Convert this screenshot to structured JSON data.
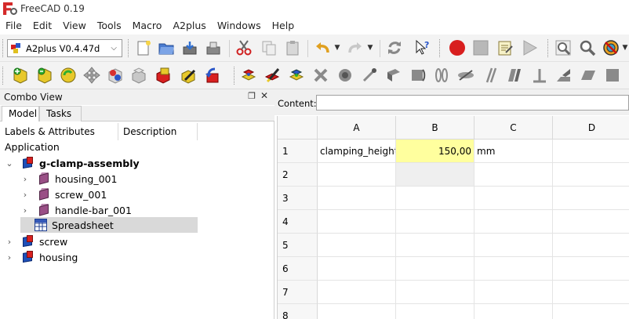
{
  "window": {
    "title": "FreeCAD 0.19"
  },
  "menu": [
    "File",
    "Edit",
    "View",
    "Tools",
    "Macro",
    "A2plus",
    "Windows",
    "Help"
  ],
  "workbench": {
    "selected": "A2plus V0.4.47d"
  },
  "combo_view": {
    "title": "Combo View",
    "tabs": [
      "Model",
      "Tasks"
    ],
    "active_tab": "Model",
    "columns": [
      "Labels & Attributes",
      "Description"
    ],
    "root_label": "Application",
    "tree": [
      {
        "label": "g-clamp-assembly",
        "icon": "assembly-icon",
        "expanded": true
      },
      {
        "label": "housing_001",
        "icon": "part-icon"
      },
      {
        "label": "screw_001",
        "icon": "part-icon"
      },
      {
        "label": "handle-bar_001",
        "icon": "part-icon"
      },
      {
        "label": "Spreadsheet",
        "icon": "spreadsheet-icon",
        "selected": true
      },
      {
        "label": "screw",
        "icon": "assembly-icon"
      },
      {
        "label": "housing",
        "icon": "assembly-icon"
      }
    ]
  },
  "spreadsheet": {
    "content_label": "Content:",
    "content_value": "",
    "columns": [
      "A",
      "B",
      "C",
      "D"
    ],
    "rows": [
      "1",
      "2",
      "3",
      "4",
      "5",
      "6",
      "7",
      "8"
    ],
    "cells": {
      "A1": "clamping_height",
      "B1": "150,00",
      "C1": "mm"
    },
    "highlight_color": "#ffff9e"
  },
  "colors": {
    "record": "#d81e1e",
    "selection": "#d9d9d9"
  }
}
